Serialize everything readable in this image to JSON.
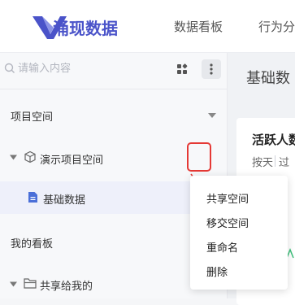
{
  "header": {
    "logo_text": "涌现数据",
    "nav": [
      "数据看板",
      "行为分"
    ]
  },
  "sidebar": {
    "search": {
      "placeholder": "请输入内容"
    },
    "section_project": "项目空间",
    "project_item": "演示项目空间",
    "child_item": "基础数据",
    "section_board": "我的看板",
    "shared_item": "共享给我的"
  },
  "main": {
    "title": "基础数",
    "card": {
      "title": "活跃人数",
      "sub_left": "按天",
      "sub_right": "过"
    }
  },
  "context_menu": {
    "items": [
      "共享空间",
      "移交空间",
      "重命名",
      "删除"
    ]
  },
  "colors": {
    "accent": "#4a53c9",
    "highlight_box": "#e53935"
  }
}
